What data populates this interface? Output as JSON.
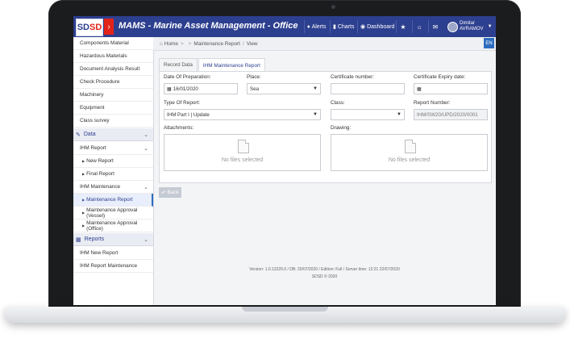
{
  "app": {
    "logo_left": "SD",
    "logo_right": "SD",
    "title": "MAMS - Marine Asset Management - Office"
  },
  "topbar": {
    "alerts": "Alerts",
    "charts": "Charts",
    "dashboard": "Dashboard",
    "user_first": "Dimitar",
    "user_last": "AVRAMOV"
  },
  "sidebar": {
    "items_top": [
      "Components Material",
      "Hazardous Materials",
      "Document Analysis Result",
      "Check Procedure",
      "Machinery",
      "Equipment",
      "Class survey"
    ],
    "data_section": "Data",
    "ihm_report": "IHM Report",
    "new_report": "New Report",
    "final_report": "Final Report",
    "ihm_maintenance": "IHM Maintenance",
    "maintenance_report": "Maintenance Report",
    "approval_vessel": "Maintenance Approval (Vessel)",
    "approval_office": "Maintenance Approval (Office)",
    "reports_section": "Reports",
    "ihm_new_report": "IHM New Report",
    "ihm_report_maintenance": "IHM Report Maintenance"
  },
  "breadcrumb": {
    "home": "Home",
    "maintenance_report": "Maintenance Report",
    "view": "View",
    "lang": "EN"
  },
  "tabs": {
    "record_data": "Record Data",
    "ihm_maintenance_report": "IHM Maintenance Report"
  },
  "form": {
    "date_label": "Date Of Preparation:",
    "date_value": "16/01/2020",
    "place_label": "Place:",
    "place_value": "Sea",
    "cert_number_label": "Certificate number:",
    "cert_number_value": "",
    "cert_expiry_label": "Certificate Expiry date:",
    "cert_expiry_value": "",
    "type_label": "Type Of Report:",
    "type_value": "IHM Part I | Update",
    "class_label": "Class:",
    "class_value": "",
    "report_number_label": "Report Number:",
    "report_number_value": "IHM/SW20/UPD/2020/0001",
    "attachments_label": "Attachments:",
    "drawing_label": "Drawing:",
    "no_files": "No files selected"
  },
  "actions": {
    "back": "Back"
  },
  "footer": {
    "version": "Version: 1.0.13229.0 / DB: 20/07/2020 / Edition: Full / Server time: 12:21 22/07/2020",
    "copyright": "SDSD © 2020"
  },
  "colors": {
    "brand": "#2d3f8f",
    "accent_red": "#e2231a",
    "link": "#2d6cc0"
  }
}
